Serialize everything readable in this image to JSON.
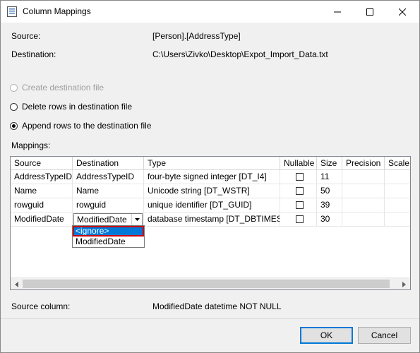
{
  "window": {
    "title": "Column Mappings"
  },
  "info": {
    "source_label": "Source:",
    "source_value": "[Person].[AddressType]",
    "destination_label": "Destination:",
    "destination_value": "C:\\Users\\Zivko\\Desktop\\Expot_Import_Data.txt"
  },
  "options": [
    {
      "label": "Create destination file",
      "selected": false,
      "enabled": false
    },
    {
      "label": "Delete rows in destination file",
      "selected": false,
      "enabled": true
    },
    {
      "label": "Append rows to the destination file",
      "selected": true,
      "enabled": true
    }
  ],
  "mappings": {
    "label": "Mappings:",
    "columns": [
      "Source",
      "Destination",
      "Type",
      "Nullable",
      "Size",
      "Precision",
      "Scale"
    ],
    "rows": [
      {
        "source": "AddressTypeID",
        "destination": "AddressTypeID",
        "type": "four-byte signed integer [DT_I4]",
        "nullable": false,
        "size": "11",
        "precision": "",
        "scale": ""
      },
      {
        "source": "Name",
        "destination": "Name",
        "type": "Unicode string [DT_WSTR]",
        "nullable": false,
        "size": "50",
        "precision": "",
        "scale": ""
      },
      {
        "source": "rowguid",
        "destination": "rowguid",
        "type": "unique identifier [DT_GUID]",
        "nullable": false,
        "size": "39",
        "precision": "",
        "scale": ""
      },
      {
        "source": "ModifiedDate",
        "destination": "ModifiedDate",
        "type": "database timestamp [DT_DBTIMES...",
        "nullable": false,
        "size": "30",
        "precision": "",
        "scale": ""
      }
    ],
    "dropdown_options": [
      "<ignore>",
      "ModifiedDate"
    ],
    "dropdown_highlighted": "<ignore>"
  },
  "source_column": {
    "label": "Source column:",
    "value": "ModifiedDate datetime NOT NULL"
  },
  "buttons": {
    "ok": "OK",
    "cancel": "Cancel"
  },
  "colors": {
    "highlight": "#0078d7",
    "focus_outline": "#c8000f",
    "window_bg": "#f0f0f0"
  }
}
